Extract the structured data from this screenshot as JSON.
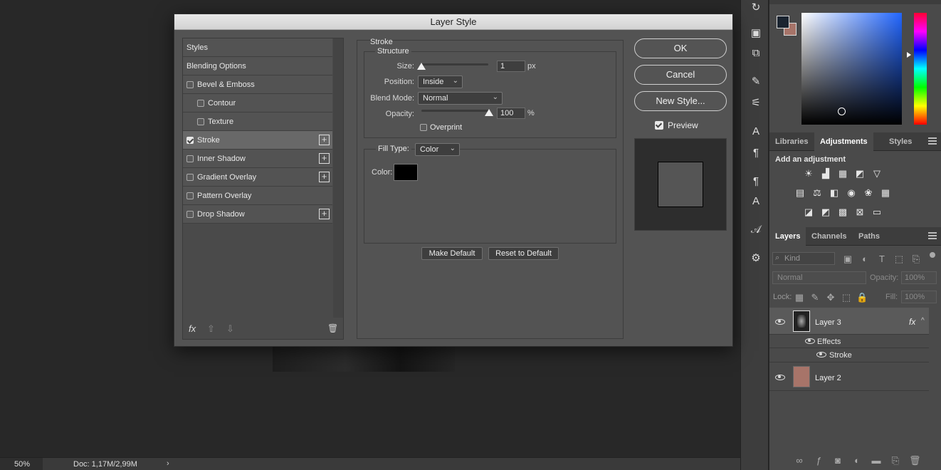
{
  "document": {
    "zoom": "50%",
    "doc_info": "Doc: 1,17M/2,99M"
  },
  "dialog": {
    "title": "Layer Style",
    "styles": [
      {
        "label": "Styles",
        "checkbox": false,
        "checked": false,
        "plus": false,
        "indent": 0
      },
      {
        "label": "Blending Options",
        "checkbox": false,
        "checked": false,
        "plus": false,
        "indent": 0
      },
      {
        "label": "Bevel & Emboss",
        "checkbox": true,
        "checked": false,
        "plus": false,
        "indent": 0
      },
      {
        "label": "Contour",
        "checkbox": true,
        "checked": false,
        "plus": false,
        "indent": 1
      },
      {
        "label": "Texture",
        "checkbox": true,
        "checked": false,
        "plus": false,
        "indent": 1
      },
      {
        "label": "Stroke",
        "checkbox": true,
        "checked": true,
        "plus": true,
        "indent": 0
      },
      {
        "label": "Inner Shadow",
        "checkbox": true,
        "checked": false,
        "plus": true,
        "indent": 0
      },
      {
        "label": "Gradient Overlay",
        "checkbox": true,
        "checked": false,
        "plus": true,
        "indent": 0
      },
      {
        "label": "Pattern Overlay",
        "checkbox": true,
        "checked": false,
        "plus": false,
        "indent": 0
      },
      {
        "label": "Drop Shadow",
        "checkbox": true,
        "checked": false,
        "plus": true,
        "indent": 0
      }
    ],
    "footer": {
      "fx_label": "fx"
    },
    "stroke": {
      "title": "Stroke",
      "structure_title": "Structure",
      "size_label": "Size:",
      "size_value": "1",
      "size_unit": "px",
      "position_label": "Position:",
      "position_value": "Inside",
      "blend_label": "Blend Mode:",
      "blend_value": "Normal",
      "opacity_label": "Opacity:",
      "opacity_value": "100",
      "opacity_unit": "%",
      "overprint_label": "Overprint",
      "fill_type_label": "Fill Type:",
      "fill_type_value": "Color",
      "color_label": "Color:",
      "color_hex": "#000000",
      "make_default": "Make Default",
      "reset_default": "Reset to Default"
    },
    "buttons": {
      "ok": "OK",
      "cancel": "Cancel",
      "new_style": "New Style...",
      "preview_label": "Preview"
    }
  },
  "adjustments": {
    "tabs": [
      "Libraries",
      "Adjustments",
      "Styles"
    ],
    "active_tab": "Adjustments",
    "heading": "Add an adjustment"
  },
  "layers_panel": {
    "tabs": [
      "Layers",
      "Channels",
      "Paths"
    ],
    "active_tab": "Layers",
    "kind_label": "Kind",
    "blend_mode": "Normal",
    "opacity_label": "Opacity:",
    "opacity_value": "100%",
    "lock_label": "Lock:",
    "fill_label": "Fill:",
    "fill_value": "100%",
    "layers": [
      {
        "name": "Layer 3",
        "fx": "fx",
        "effects_label": "Effects",
        "effect_items": [
          "Stroke"
        ]
      },
      {
        "name": "Layer 2",
        "thumb_color": "#a77469"
      }
    ]
  },
  "colors": {
    "foreground": "#1a2430",
    "background": "#a77469",
    "accent_layer_thumb": "#a77469"
  }
}
